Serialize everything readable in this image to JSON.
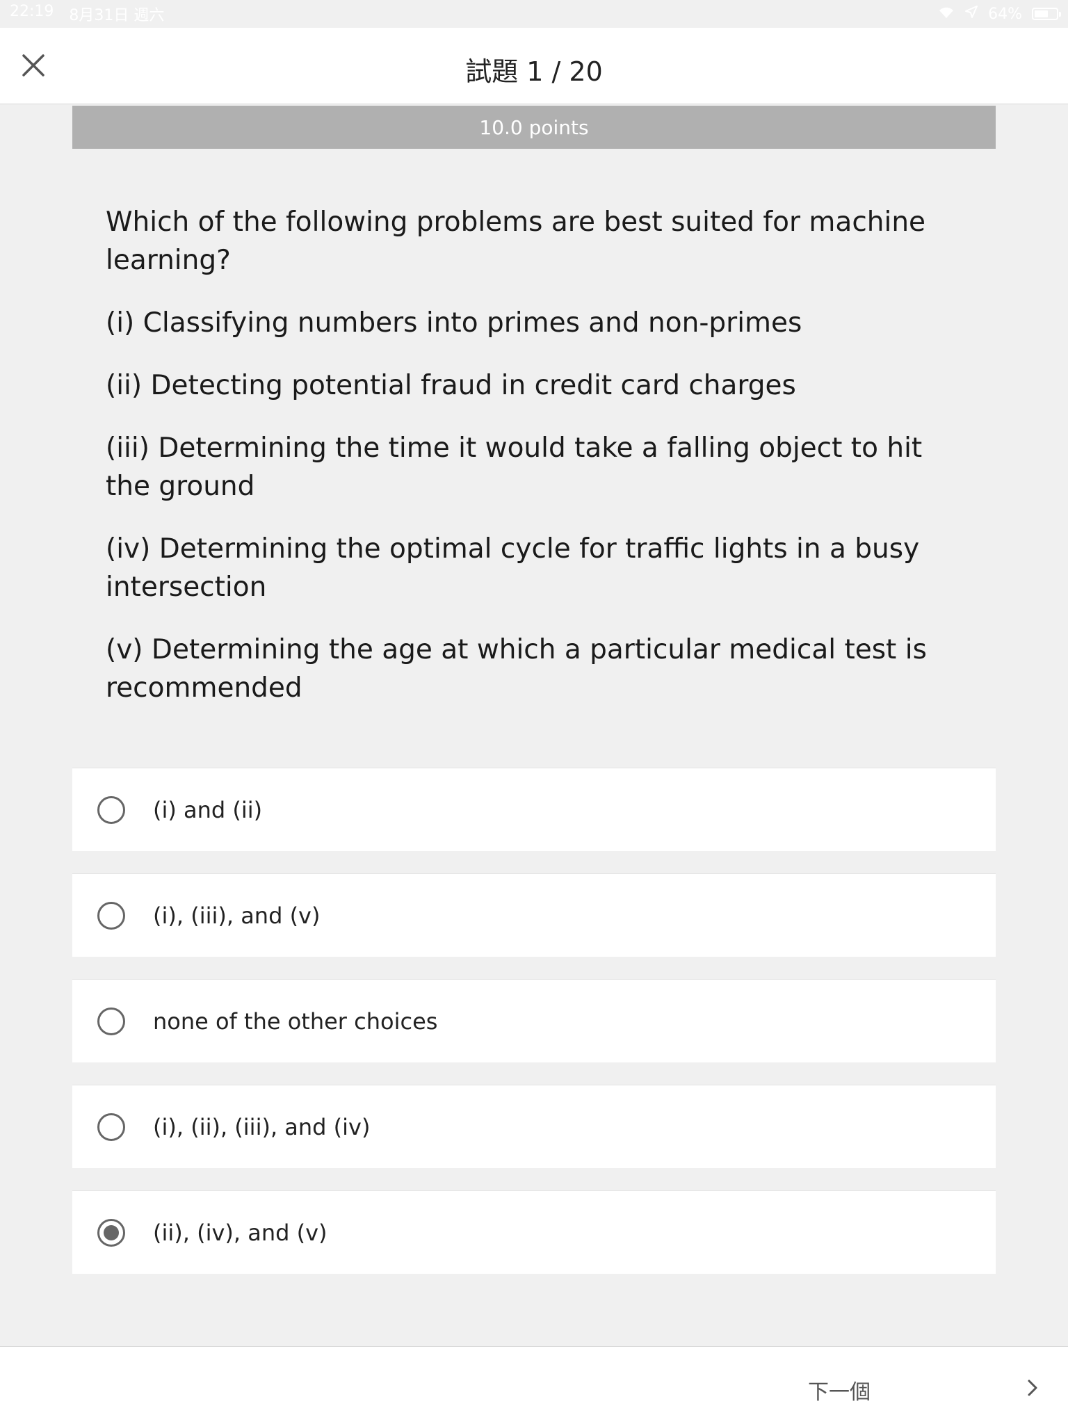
{
  "status_bar": {
    "time": "22:19",
    "date": "8月31日 週六",
    "battery": "64%",
    "battery_fraction": 0.64
  },
  "header": {
    "title": "試題 1 / 20"
  },
  "points_label": "10.0 points",
  "question": {
    "prompt": "Which of the following problems are best suited for machine learning?",
    "items": [
      "(i) Classifying numbers into primes and non-primes",
      "(ii) Detecting potential fraud in credit card charges",
      "(iii) Determining the time it would take a falling object to hit the ground",
      "(iv) Determining the optimal cycle for traffic lights in a busy intersection",
      "(v) Determining the age at which a particular medical test is recommended"
    ]
  },
  "choices": [
    {
      "label": "(i) and (ii)",
      "selected": false
    },
    {
      "label": "(i), (iii), and (v)",
      "selected": false
    },
    {
      "label": "none of the other choices",
      "selected": false
    },
    {
      "label": "(i), (ii), (iii), and (iv)",
      "selected": false
    },
    {
      "label": "(ii), (iv), and (v)",
      "selected": true
    }
  ],
  "footer": {
    "next_label": "下一個"
  }
}
